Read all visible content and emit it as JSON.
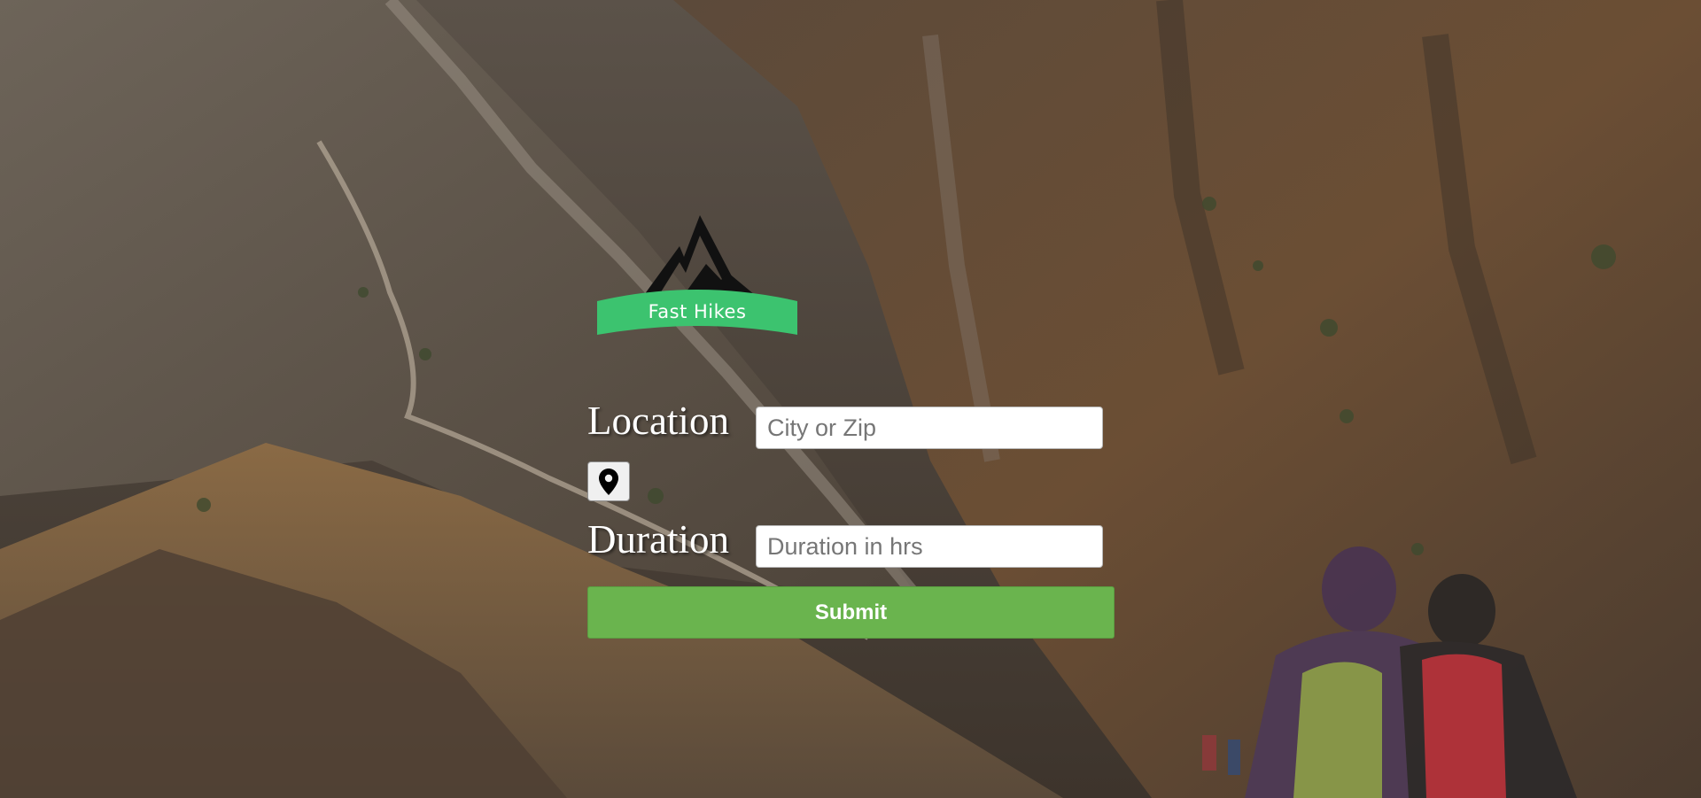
{
  "logo": {
    "name": "Fast Hikes",
    "colors": {
      "banner": "#3cc36f",
      "mountain": "#111111"
    }
  },
  "form": {
    "location": {
      "label": "Location",
      "value": "",
      "placeholder": "City or Zip"
    },
    "geolocate": {
      "icon": "map-pin-icon"
    },
    "duration": {
      "label": "Duration",
      "value": "",
      "placeholder": "Duration in hrs"
    },
    "submit_label": "Submit"
  },
  "theme": {
    "accent": "#6ab44e"
  }
}
